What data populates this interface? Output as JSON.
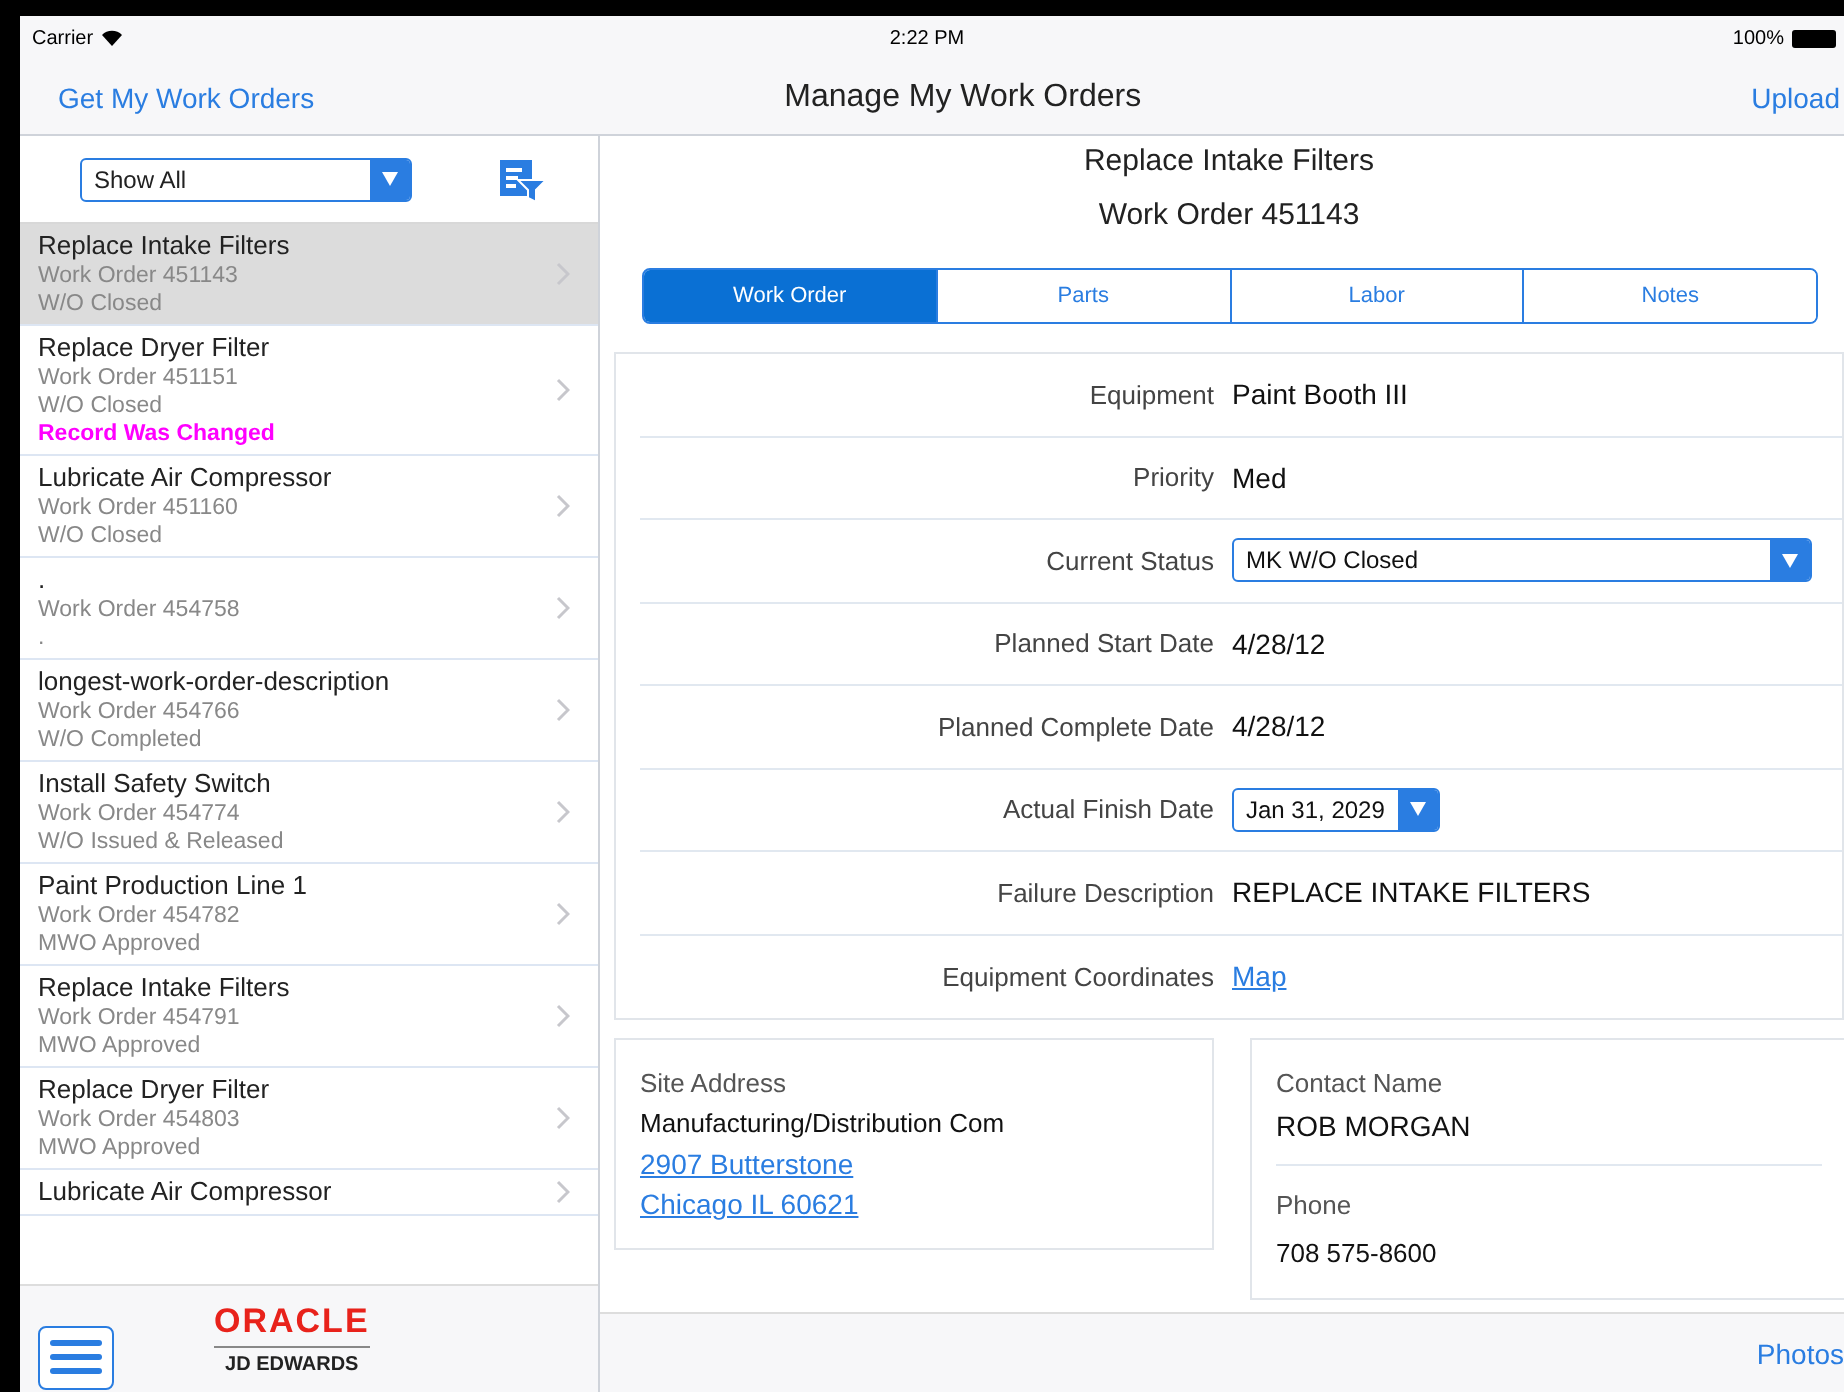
{
  "status_bar": {
    "carrier": "Carrier",
    "time": "2:22 PM",
    "battery": "100%"
  },
  "nav_bar": {
    "left_button": "Get My Work Orders",
    "title": "Manage My Work Orders",
    "right_button": "Upload"
  },
  "sidebar": {
    "filter": {
      "value": "Show All"
    },
    "items": [
      {
        "title": "Replace Intake Filters",
        "lines": [
          "Work Order 451143",
          "W/O Closed"
        ],
        "selected": true
      },
      {
        "title": "Replace Dryer Filter",
        "lines": [
          "Work Order 451151",
          "W/O Closed"
        ],
        "note": "Record Was Changed",
        "selected": false
      },
      {
        "title": "Lubricate Air Compressor",
        "lines": [
          "Work Order 451160",
          "W/O Closed"
        ],
        "selected": false
      },
      {
        "title": ".",
        "lines": [
          "Work Order 454758",
          "."
        ],
        "selected": false
      },
      {
        "title": "longest-work-order-description",
        "lines": [
          "Work Order 454766",
          "W/O Completed"
        ],
        "selected": false
      },
      {
        "title": "Install Safety Switch",
        "lines": [
          "Work Order 454774",
          "W/O Issued & Released"
        ],
        "selected": false
      },
      {
        "title": "Paint Production Line 1",
        "lines": [
          "Work Order 454782",
          "MWO Approved"
        ],
        "selected": false
      },
      {
        "title": "Replace Intake Filters",
        "lines": [
          "Work Order 454791",
          "MWO Approved"
        ],
        "selected": false
      },
      {
        "title": "Replace Dryer Filter",
        "lines": [
          "Work Order 454803",
          "MWO Approved"
        ],
        "selected": false
      },
      {
        "title": "Lubricate Air Compressor",
        "selected": false
      }
    ],
    "logo": {
      "brand": "ORACLE",
      "product": "JD EDWARDS"
    }
  },
  "detail": {
    "title": "Replace Intake Filters",
    "subtitle": "Work Order 451143",
    "tabs": [
      {
        "label": "Work Order",
        "selected": true
      },
      {
        "label": "Parts",
        "selected": false
      },
      {
        "label": "Labor",
        "selected": false
      },
      {
        "label": "Notes",
        "selected": false
      }
    ],
    "fields": [
      {
        "label": "Equipment",
        "value": "Paint Booth III",
        "kind": "text"
      },
      {
        "label": "Priority",
        "value": "Med",
        "kind": "text"
      },
      {
        "label": "Current Status",
        "value": "MK W/O Closed",
        "kind": "select"
      },
      {
        "label": "Planned Start Date",
        "value": "4/28/12",
        "kind": "text"
      },
      {
        "label": "Planned Complete Date",
        "value": "4/28/12",
        "kind": "text"
      },
      {
        "label": "Actual Finish Date",
        "value": "Jan 31, 2029",
        "kind": "date"
      },
      {
        "label": "Failure Description",
        "value": "REPLACE INTAKE FILTERS",
        "kind": "text"
      },
      {
        "label": "Equipment Coordinates",
        "value": "Map",
        "kind": "link"
      }
    ],
    "site": {
      "label": "Site Address",
      "name": "Manufacturing/Distribution Com",
      "address_lines": [
        "2907 Butterstone",
        "Chicago IL 60621"
      ]
    },
    "contact": {
      "name_label": "Contact Name",
      "name": "ROB MORGAN",
      "phone_label": "Phone",
      "phone": "708 575-8600"
    },
    "toolbar_button": "Photos"
  }
}
